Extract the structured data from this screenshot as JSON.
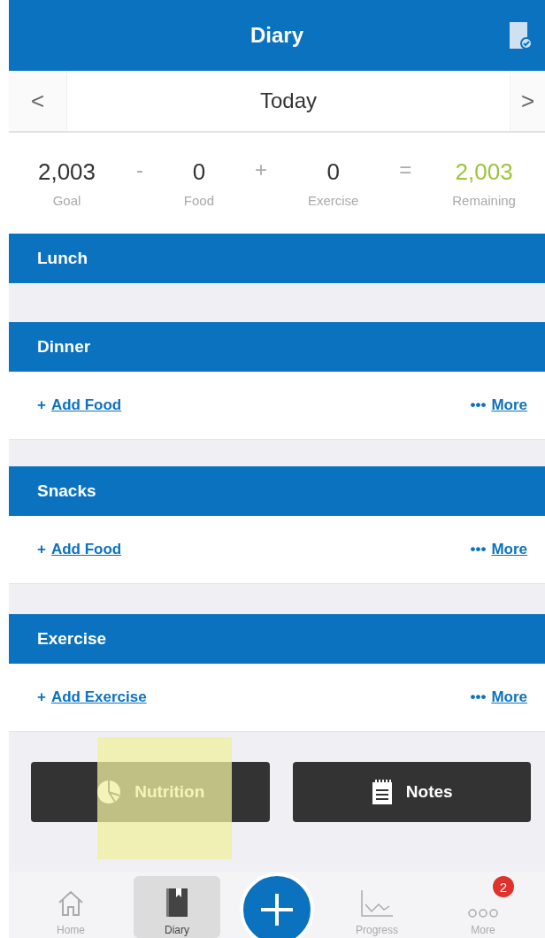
{
  "header": {
    "title": "Diary"
  },
  "date_nav": {
    "prev": "<",
    "label": "Today",
    "next": ">"
  },
  "summary": [
    {
      "value": "2,003",
      "label": "Goal",
      "kind": "term"
    },
    {
      "value": "-",
      "kind": "op"
    },
    {
      "value": "0",
      "label": "Food",
      "kind": "term"
    },
    {
      "value": "+",
      "kind": "op"
    },
    {
      "value": "0",
      "label": "Exercise",
      "kind": "term"
    },
    {
      "value": "=",
      "kind": "op"
    },
    {
      "value": "2,003",
      "label": "Remaining",
      "kind": "result"
    }
  ],
  "sections": [
    {
      "title": "Lunch"
    },
    {
      "title": "Dinner",
      "add_mark": "+",
      "add": "Add Food",
      "more_mark": "•••",
      "more": "More"
    },
    {
      "title": "Snacks",
      "add_mark": "+",
      "add": "Add Food",
      "more_mark": "•••",
      "more": "More"
    },
    {
      "title": "Exercise",
      "add_mark": "+",
      "add": "Add Exercise",
      "more_mark": "•••",
      "more": "More"
    }
  ],
  "actions": [
    {
      "label": "Nutrition",
      "kind": "nutrition",
      "highlighted": true
    },
    {
      "label": "Notes",
      "kind": "notes",
      "highlighted": false
    }
  ],
  "tabs": [
    {
      "label": "Home",
      "kind": "home",
      "selected": false
    },
    {
      "label": "Diary",
      "kind": "diary",
      "selected": true
    },
    {
      "kind": "add"
    },
    {
      "label": "Progress",
      "kind": "progress",
      "selected": false
    },
    {
      "label": "More",
      "kind": "more",
      "selected": false,
      "badge": "2"
    }
  ]
}
